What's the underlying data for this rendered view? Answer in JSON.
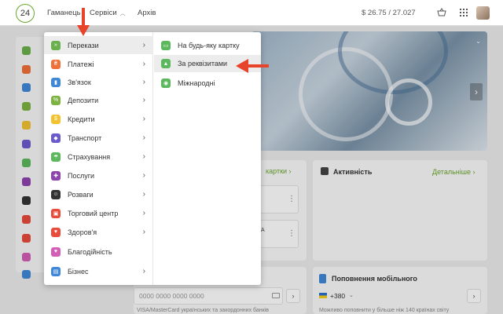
{
  "header": {
    "logo_text": "24",
    "nav": [
      {
        "label": "Гаманець"
      },
      {
        "label": "Сервіси"
      },
      {
        "label": "Архів"
      }
    ],
    "balance": "$ 26.75  /  27.027"
  },
  "menu": {
    "categories": [
      {
        "label": "Перекази",
        "color": "#6ab04c",
        "icon": "transfer-icon",
        "active": true
      },
      {
        "label": "Платежі",
        "color": "#f0703a",
        "icon": "payment-icon"
      },
      {
        "label": "Зв'язок",
        "color": "#3f88d8",
        "icon": "phone-icon"
      },
      {
        "label": "Депозити",
        "color": "#7cb342",
        "icon": "percent-icon"
      },
      {
        "label": "Кредити",
        "color": "#f2c230",
        "icon": "money-bag-icon"
      },
      {
        "label": "Транспорт",
        "color": "#6a5acd",
        "icon": "car-icon"
      },
      {
        "label": "Страхування",
        "color": "#5cb85c",
        "icon": "umbrella-icon"
      },
      {
        "label": "Послуги",
        "color": "#8e44ad",
        "icon": "puzzle-icon"
      },
      {
        "label": "Розваги",
        "color": "#333333",
        "icon": "smile-icon"
      },
      {
        "label": "Торговий центр",
        "color": "#e74c3c",
        "icon": "shopping-icon"
      },
      {
        "label": "Здоров'я",
        "color": "#e74c3c",
        "icon": "heart-icon"
      },
      {
        "label": "Благодійність",
        "color": "#d35fb7",
        "icon": "charity-icon"
      },
      {
        "label": "Бізнес",
        "color": "#3f88d8",
        "icon": "briefcase-icon"
      }
    ],
    "subitems": [
      {
        "label": "На будь-яку картку",
        "icon": "card-icon"
      },
      {
        "label": "За реквізитами",
        "icon": "bank-icon",
        "active": true
      },
      {
        "label": "Міжнародні",
        "icon": "globe-icon"
      }
    ]
  },
  "background": {
    "card_transfer_link": "картки",
    "activity_title": "Активність",
    "activity_link": "Детальніше",
    "card_number_placeholder": "0000 0000 0000 0000",
    "card_hint": "VISA/MasterCard українських та закордонних банків",
    "mobile_title": "Поповнення мобільного",
    "phone_prefix": "+380",
    "mobile_hint": "Можливо поповнити у більше ніж 140 країнах світу",
    "partial_a": "А"
  },
  "colors": {
    "accent_green": "#6aa52d",
    "annotation_red": "#e8432b"
  }
}
